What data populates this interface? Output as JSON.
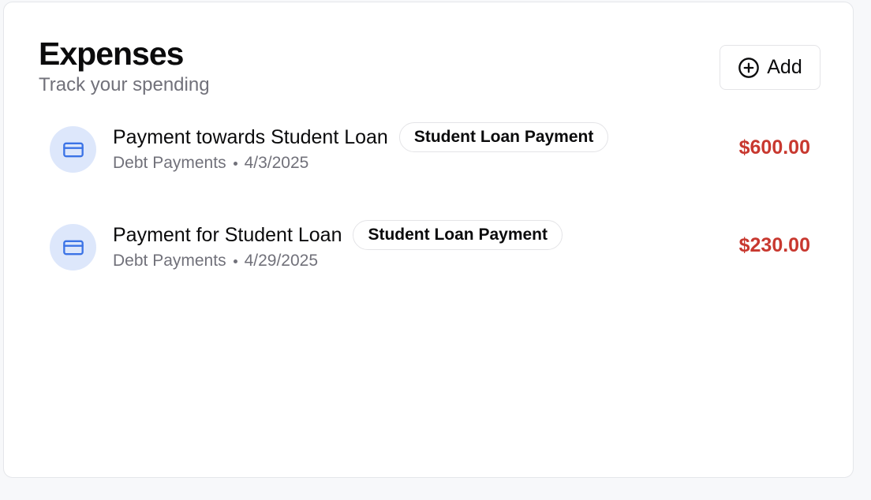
{
  "header": {
    "title": "Expenses",
    "subtitle": "Track your spending",
    "add_label": "Add"
  },
  "colors": {
    "amount": "#c8382f",
    "icon_bg": "#dde7fb",
    "icon_stroke": "#3b73e6"
  },
  "expenses": [
    {
      "title": "Payment towards Student Loan",
      "tag": "Student Loan Payment",
      "category": "Debt Payments",
      "date": "4/3/2025",
      "amount": "$600.00",
      "icon": "credit-card-icon"
    },
    {
      "title": "Payment for Student Loan",
      "tag": "Student Loan Payment",
      "category": "Debt Payments",
      "date": "4/29/2025",
      "amount": "$230.00",
      "icon": "credit-card-icon"
    }
  ]
}
